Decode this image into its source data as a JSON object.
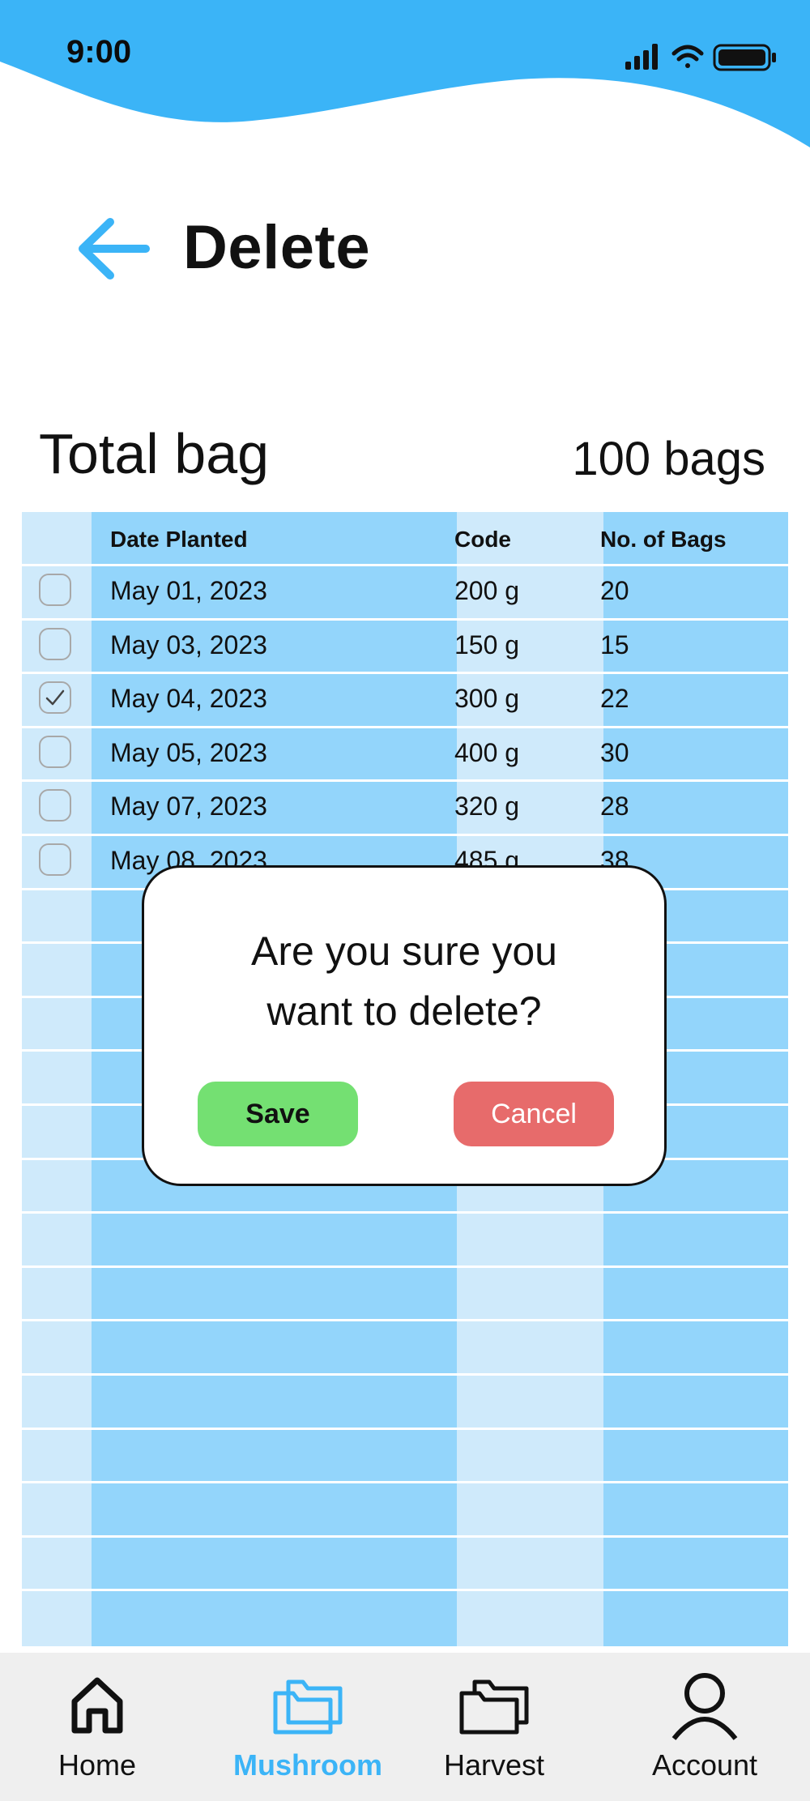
{
  "status_bar": {
    "time": "9:00"
  },
  "header": {
    "title": "Delete"
  },
  "summary": {
    "label": "Total bag",
    "value": "100 bags"
  },
  "table": {
    "headers": [
      "Date Planted",
      "Code",
      "No. of Bags"
    ],
    "rows": [
      {
        "checked": false,
        "date": "May 01, 2023",
        "code": "200 g",
        "bags": "20"
      },
      {
        "checked": false,
        "date": "May 03, 2023",
        "code": "150 g",
        "bags": "15"
      },
      {
        "checked": true,
        "date": "May 04, 2023",
        "code": "300 g",
        "bags": "22"
      },
      {
        "checked": false,
        "date": "May 05, 2023",
        "code": "400 g",
        "bags": "30"
      },
      {
        "checked": false,
        "date": "May 07, 2023",
        "code": "320 g",
        "bags": "28"
      },
      {
        "checked": false,
        "date": "May 08, 2023",
        "code": "485 g",
        "bags": "38"
      }
    ]
  },
  "dialog": {
    "message_line1": "Are you sure you",
    "message_line2": "want to delete?",
    "save_label": "Save",
    "cancel_label": "Cancel"
  },
  "nav": {
    "items": [
      {
        "label": "Home",
        "icon": "home-icon",
        "active": false
      },
      {
        "label": "Mushroom",
        "icon": "folder-icon",
        "active": true
      },
      {
        "label": "Harvest",
        "icon": "folders-icon",
        "active": false
      },
      {
        "label": "Account",
        "icon": "user-icon",
        "active": false
      }
    ]
  },
  "colors": {
    "accent": "#3bb4f7",
    "table_dark": "#93d5fb",
    "table_light": "#cfeafb",
    "save": "#74e072",
    "cancel": "#e76b6b",
    "nav_bg": "#efefef"
  }
}
